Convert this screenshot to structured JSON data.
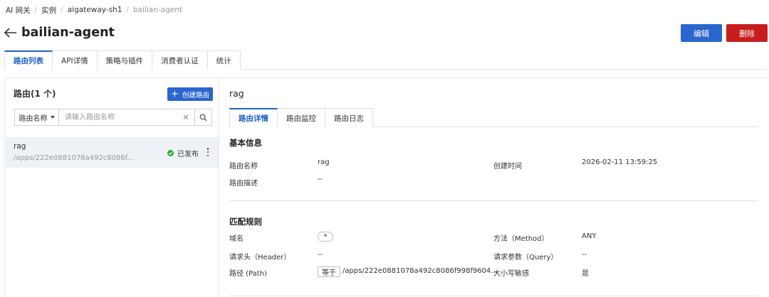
{
  "breadcrumb": [
    "AI 网关",
    "实例",
    "aigateway-sh1",
    "bailian-agent"
  ],
  "page_title": "bailian-agent",
  "actions": {
    "edit": "编辑",
    "delete": "删除"
  },
  "top_tabs": [
    "路由列表",
    "API详情",
    "策略与插件",
    "消费者认证",
    "统计"
  ],
  "sidebar": {
    "title": "路由(1 个)",
    "create_label": "创建路由",
    "search_select": "路由名称",
    "search_placeholder": "请输入路由名称",
    "routes": [
      {
        "name": "rag",
        "path": "/apps/222e0881078a492c8086f...",
        "status": "已发布"
      }
    ]
  },
  "detail": {
    "title": "rag",
    "tabs": [
      "路由详情",
      "路由监控",
      "路由日志"
    ],
    "basic": {
      "title": "基本信息",
      "name_label": "路由名称",
      "name_value": "rag",
      "created_label": "创建时间",
      "created_value": "2026-02-11 13:59:25",
      "desc_label": "路由描述",
      "desc_value": "--"
    },
    "match": {
      "title": "匹配规则",
      "domain_label": "域名",
      "domain_value": "*",
      "method_label": "方法（Method）",
      "method_value": "ANY",
      "header_label": "请求头（Header）",
      "header_value": "--",
      "query_label": "请求参数（Query）",
      "query_value": "--",
      "path_label": "路径 (Path)",
      "path_op": "等于",
      "path_value": "/apps/222e0881078a492c8086f998f9604...",
      "case_label": "大小写敏感",
      "case_value": "是"
    }
  },
  "colors": {
    "primary": "#2a66ce",
    "danger": "#c81d1d",
    "success": "#2eaa3a"
  }
}
